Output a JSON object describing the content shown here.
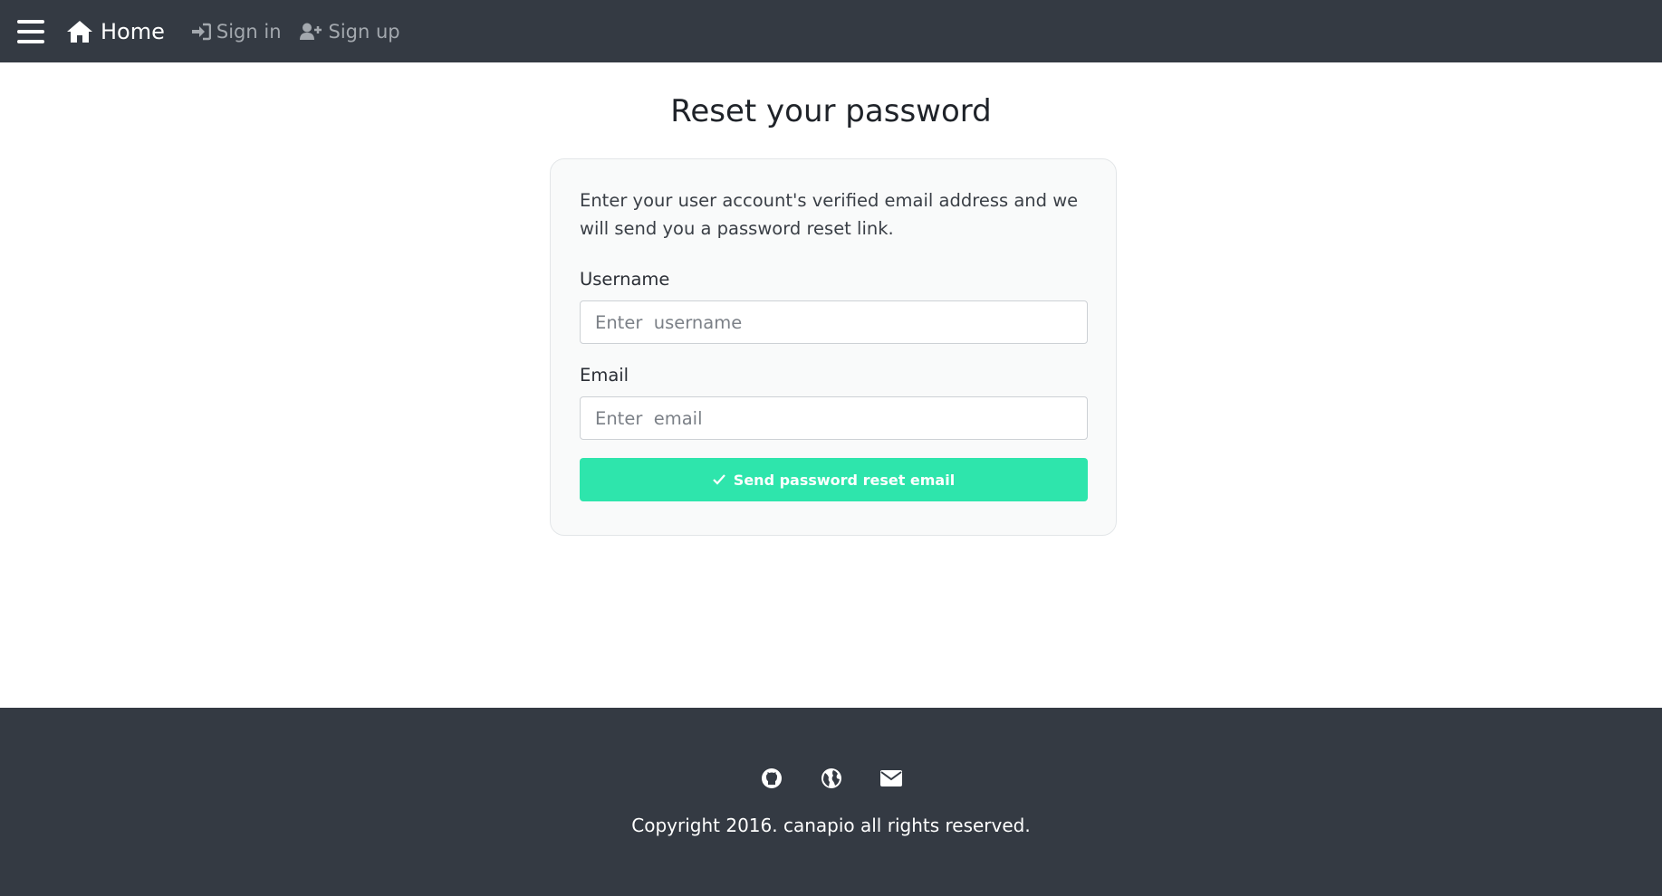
{
  "nav": {
    "home_label": "Home",
    "signin_label": "Sign in",
    "signup_label": "Sign up"
  },
  "main": {
    "title": "Reset your password",
    "description": "Enter your user account's verified email address and we will send you a password reset link.",
    "username_label": "Username",
    "username_placeholder": "Enter  username",
    "email_label": "Email",
    "email_placeholder": "Enter  email",
    "submit_label": "Send  password  reset  email"
  },
  "footer": {
    "icons": [
      "github-icon",
      "globe-icon",
      "envelope-icon"
    ],
    "copyright": "Copyright 2016. canapio all rights reserved."
  },
  "colors": {
    "navbar_bg": "#343a43",
    "accent_button": "#2ee5ac",
    "footer_bg": "#343a43"
  }
}
